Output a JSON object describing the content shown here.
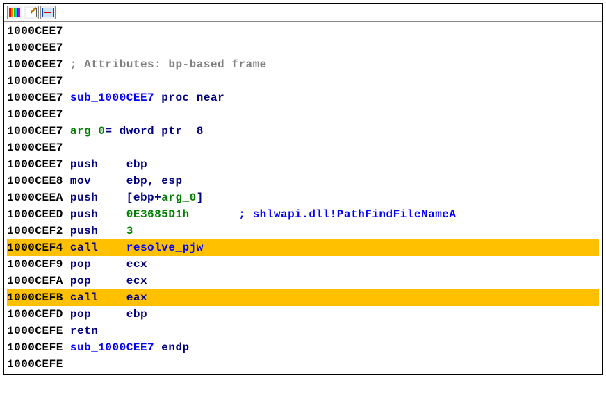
{
  "toolbar": {
    "icons": [
      "colors",
      "edit",
      "graph"
    ]
  },
  "lines": [
    {
      "addr": "1000CEE7",
      "tokens": [],
      "highlighted": false
    },
    {
      "addr": "1000CEE7",
      "tokens": [],
      "highlighted": false
    },
    {
      "addr": "1000CEE7",
      "tokens": [
        {
          "text": "; Attributes: bp-based frame",
          "cls": "comment-gray"
        }
      ],
      "highlighted": false
    },
    {
      "addr": "1000CEE7",
      "tokens": [],
      "highlighted": false
    },
    {
      "addr": "1000CEE7",
      "tokens": [
        {
          "text": "sub_1000CEE7 ",
          "cls": "proc"
        },
        {
          "text": "proc near",
          "cls": "keyword"
        }
      ],
      "highlighted": false
    },
    {
      "addr": "1000CEE7",
      "tokens": [],
      "highlighted": false
    },
    {
      "addr": "1000CEE7",
      "tokens": [
        {
          "text": "arg_0",
          "cls": "arg"
        },
        {
          "text": "= ",
          "cls": "keyword"
        },
        {
          "text": "dword ptr  8",
          "cls": "keyword"
        }
      ],
      "highlighted": false
    },
    {
      "addr": "1000CEE7",
      "tokens": [],
      "highlighted": false
    },
    {
      "addr": "1000CEE7",
      "tokens": [
        {
          "text": "push    ",
          "cls": "keyword"
        },
        {
          "text": "ebp",
          "cls": "operand"
        }
      ],
      "highlighted": false
    },
    {
      "addr": "1000CEE8",
      "tokens": [
        {
          "text": "mov     ",
          "cls": "keyword"
        },
        {
          "text": "ebp",
          "cls": "operand"
        },
        {
          "text": ", ",
          "cls": "keyword"
        },
        {
          "text": "esp",
          "cls": "operand"
        }
      ],
      "highlighted": false
    },
    {
      "addr": "1000CEEA",
      "tokens": [
        {
          "text": "push    ",
          "cls": "keyword"
        },
        {
          "text": "[",
          "cls": "keyword"
        },
        {
          "text": "ebp",
          "cls": "operand"
        },
        {
          "text": "+",
          "cls": "keyword"
        },
        {
          "text": "arg_0",
          "cls": "arg"
        },
        {
          "text": "]",
          "cls": "keyword"
        }
      ],
      "highlighted": false
    },
    {
      "addr": "1000CEED",
      "tokens": [
        {
          "text": "push    ",
          "cls": "keyword"
        },
        {
          "text": "0E3685D1h       ",
          "cls": "arg"
        },
        {
          "text": "; shlwapi.dll!PathFindFileNameA",
          "cls": "comment-blue"
        }
      ],
      "highlighted": false
    },
    {
      "addr": "1000CEF2",
      "tokens": [
        {
          "text": "push    ",
          "cls": "keyword"
        },
        {
          "text": "3",
          "cls": "arg"
        }
      ],
      "highlighted": false
    },
    {
      "addr": "1000CEF4",
      "tokens": [
        {
          "text": "call    ",
          "cls": "keyword"
        },
        {
          "text": "resolve_pjw",
          "cls": "call-target"
        }
      ],
      "highlighted": true
    },
    {
      "addr": "1000CEF9",
      "tokens": [
        {
          "text": "pop     ",
          "cls": "keyword"
        },
        {
          "text": "ecx",
          "cls": "operand"
        }
      ],
      "highlighted": false
    },
    {
      "addr": "1000CEFA",
      "tokens": [
        {
          "text": "pop     ",
          "cls": "keyword"
        },
        {
          "text": "ecx",
          "cls": "operand"
        }
      ],
      "highlighted": false
    },
    {
      "addr": "1000CEFB",
      "tokens": [
        {
          "text": "call    ",
          "cls": "keyword"
        },
        {
          "text": "eax",
          "cls": "operand"
        }
      ],
      "highlighted": true
    },
    {
      "addr": "1000CEFD",
      "tokens": [
        {
          "text": "pop     ",
          "cls": "keyword"
        },
        {
          "text": "ebp",
          "cls": "operand"
        }
      ],
      "highlighted": false
    },
    {
      "addr": "1000CEFE",
      "tokens": [
        {
          "text": "retn",
          "cls": "keyword"
        }
      ],
      "highlighted": false
    },
    {
      "addr": "1000CEFE",
      "tokens": [
        {
          "text": "sub_1000CEE7 ",
          "cls": "proc"
        },
        {
          "text": "endp",
          "cls": "keyword"
        }
      ],
      "highlighted": false
    },
    {
      "addr": "1000CEFE",
      "tokens": [],
      "highlighted": false
    }
  ]
}
